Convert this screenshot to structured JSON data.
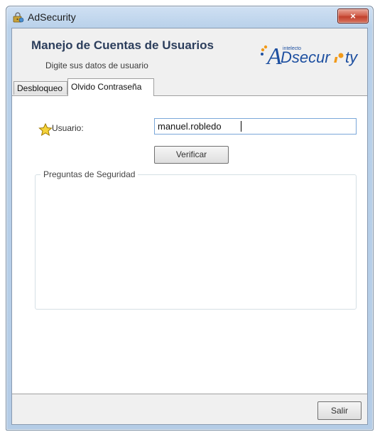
{
  "window": {
    "title": "AdSecurity",
    "close_label": "×"
  },
  "header": {
    "title": "Manejo de Cuentas de Usuarios",
    "subtitle": "Digite sus datos de usuario",
    "logo_small_text": "intelecto",
    "logo_big_text": "Dsecur",
    "logo_end_text": "ty",
    "logo_a_letter": "A"
  },
  "tabs": [
    {
      "label": "Desbloqueo",
      "active": false
    },
    {
      "label": "Olvido Contraseña",
      "active": true
    }
  ],
  "form": {
    "usuario_label": "Usuario:",
    "usuario_value": "manuel.robledo",
    "verify_label": "Verificar",
    "group_label": "Preguntas de Seguridad"
  },
  "footer": {
    "exit_label": "Salir"
  },
  "colors": {
    "header_title": "#2c3e5c",
    "logo_blue": "#1d4fa0",
    "logo_orange": "#f19a1a",
    "close_red": "#c2402c"
  },
  "icons": {
    "app": "app-security-icon",
    "user": "star-icon"
  }
}
